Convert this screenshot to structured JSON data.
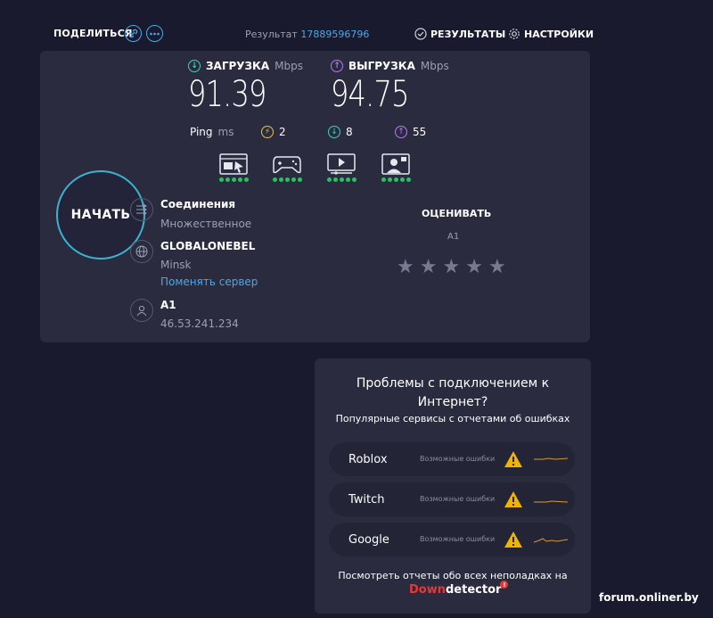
{
  "header": {
    "share_label": "ПОДЕЛИТЬСЯ",
    "result_label": "Результат",
    "result_id": "17889596796",
    "results_label": "РЕЗУЛЬТАТЫ",
    "settings_label": "НАСТРОЙКИ"
  },
  "speedtest": {
    "download_label": "ЗАГРУЗКА",
    "upload_label": "ВЫГРУЗКА",
    "unit": "Mbps",
    "download_value": "91.39",
    "upload_value": "94.75",
    "ping_label": "Ping",
    "ping_unit": "ms",
    "jitter": "2",
    "ping_download": "8",
    "ping_upload": "55",
    "start_label": "НАЧАТЬ",
    "colors": {
      "download": "#3bd4c0",
      "upload": "#b57bf5",
      "jitter": "#e8c547",
      "ring": "#3bb2d0",
      "dots": "#22c55e"
    }
  },
  "apps": [
    "browsing-icon",
    "gaming-icon",
    "video-icon",
    "video-call-icon"
  ],
  "connection": {
    "title": "Соединения",
    "value": "Множественное",
    "server_name": "GLOBALONEBEL",
    "server_city": "Minsk",
    "change_server": "Поменять сервер",
    "provider": "A1",
    "ip": "46.53.241.234"
  },
  "rating": {
    "title": "ОЦЕНИВАТЬ",
    "provider": "A1",
    "stars": [
      "★",
      "★",
      "★",
      "★",
      "★"
    ]
  },
  "problems": {
    "title_line1": "Проблемы с подключением к",
    "title_line2": "Интернет?",
    "subtitle": "Популярные сервисы с отчетами об ошибках",
    "services": [
      {
        "name": "Roblox",
        "status": "Возможные ошибки"
      },
      {
        "name": "Twitch",
        "status": "Возможные ошибки"
      },
      {
        "name": "Google",
        "status": "Возможные ошибки"
      }
    ],
    "footer": "Посмотреть отчеты обо всех неполадках на",
    "brand_down": "Down",
    "brand_detector": "detector",
    "brand_badge": "!"
  },
  "watermark": "forum.onliner.by"
}
